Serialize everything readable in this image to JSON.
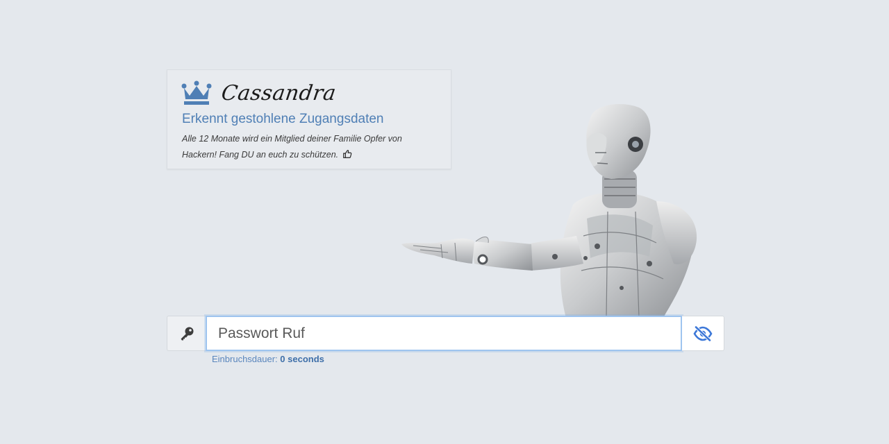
{
  "brand": {
    "name": "Cassandra",
    "tagline": "Erkennt gestohlene Zugangsdaten",
    "description": " Alle 12 Monate wird ein Mitglied deiner Familie  Opfer von Hackern! Fang DU an euch zu schützen.",
    "crown_icon": "crown-icon",
    "thumb_icon": "thumbs-up-icon",
    "accent_color": "#4f7fb5"
  },
  "password": {
    "placeholder": "Passwort Ruf",
    "value": "",
    "key_icon": "key-icon",
    "toggle_icon": "eye-slash-icon"
  },
  "crack_time": {
    "label": "Einbruchsdauer:",
    "value": "0 seconds"
  }
}
